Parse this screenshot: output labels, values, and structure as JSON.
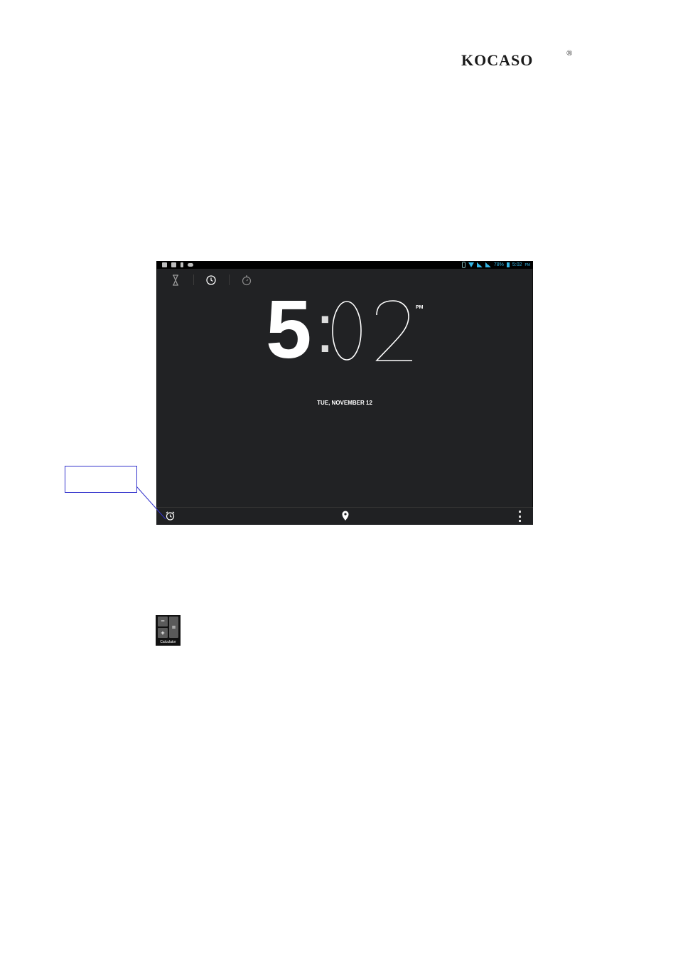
{
  "page": {
    "logo_text": "KOCASO",
    "logo_mark": "®"
  },
  "screenshot": {
    "status_bar": {
      "left_icons": [
        "screenshot-icon",
        "image-icon",
        "usb-icon",
        "game-icon"
      ],
      "right_icons": [
        "bluetooth-icon",
        "wifi-icon",
        "signal-icon",
        "signal-icon",
        "battery-icon"
      ],
      "battery_percent": "78%",
      "time": "5:02",
      "time_suffix": "PM",
      "accent_color": "#33b5e5"
    },
    "tabs": [
      {
        "icon": "hourglass-icon",
        "name": "timer"
      },
      {
        "icon": "clock-icon",
        "name": "clock",
        "selected": true
      },
      {
        "icon": "stopwatch-icon",
        "name": "stopwatch"
      }
    ],
    "clock": {
      "hour": "5",
      "separator": ":",
      "minutes": "02",
      "ampm": "PM",
      "date": "TUE, NOVEMBER 12"
    },
    "bottom_bar": {
      "left_icon": "alarm-clock-icon",
      "center_icon": "location-pin-icon",
      "right_icon": "overflow-menu-icon"
    },
    "background_color": "#212224"
  },
  "callout": {
    "text": "",
    "border_color": "#3333cc"
  },
  "calculator_icon": {
    "minus": "−",
    "plus": "+",
    "equals": "=",
    "label": "Calculator"
  }
}
